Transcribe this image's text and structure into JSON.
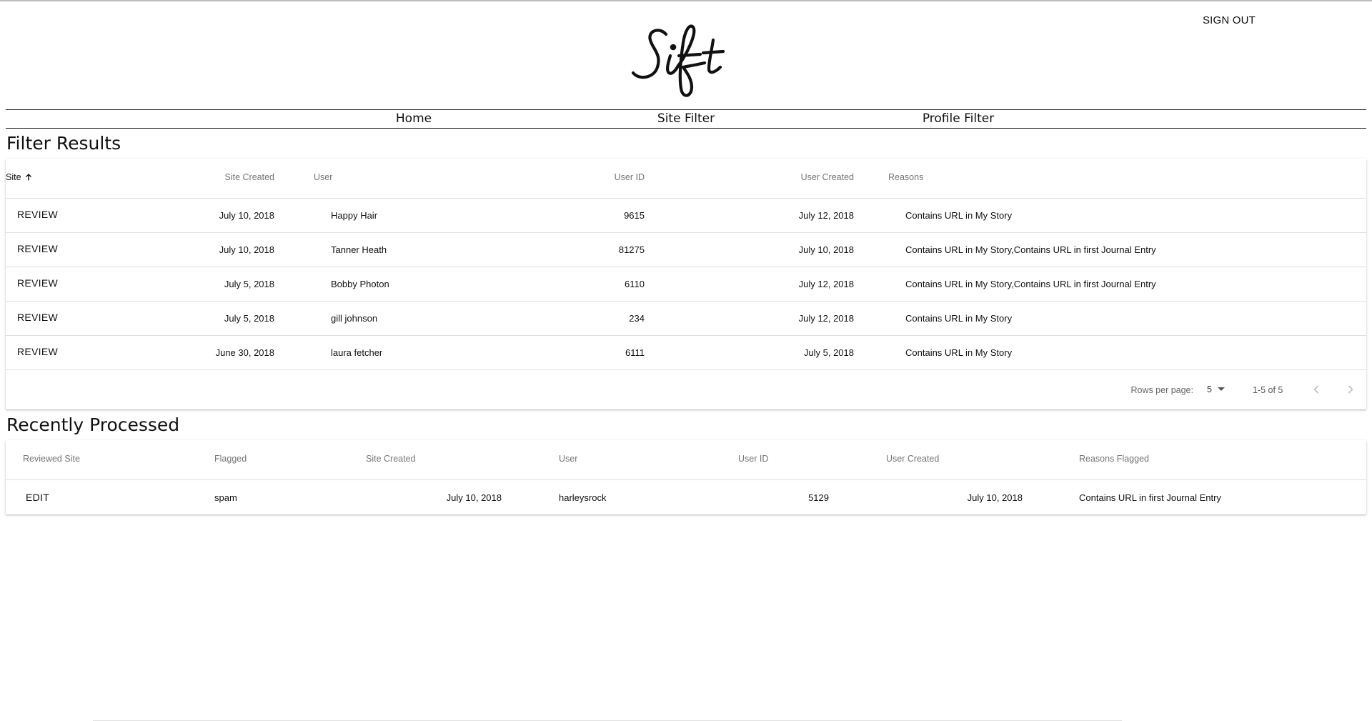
{
  "header": {
    "logo_text": "Sift",
    "sign_out_label": "SIGN OUT"
  },
  "nav": {
    "items": [
      {
        "label": "Home"
      },
      {
        "label": "Site Filter"
      },
      {
        "label": "Profile Filter"
      }
    ]
  },
  "filter_results": {
    "title": "Filter Results",
    "columns": {
      "site": "Site",
      "site_created": "Site Created",
      "user": "User",
      "user_id": "User ID",
      "user_created": "User Created",
      "reasons": "Reasons"
    },
    "sort": {
      "column": "Site",
      "direction": "ascending",
      "icon": "arrow-up-icon"
    },
    "rows": [
      {
        "action": "REVIEW",
        "site_created": "July 10, 2018",
        "user": "Happy Hair",
        "user_id": "9615",
        "user_created": "July 12, 2018",
        "reasons": "Contains URL in My Story"
      },
      {
        "action": "REVIEW",
        "site_created": "July 10, 2018",
        "user": "Tanner Heath",
        "user_id": "81275",
        "user_created": "July 10, 2018",
        "reasons": "Contains URL in My Story,Contains URL in first Journal Entry"
      },
      {
        "action": "REVIEW",
        "site_created": "July 5, 2018",
        "user": "Bobby Photon",
        "user_id": "6110",
        "user_created": "July 12, 2018",
        "reasons": "Contains URL in My Story,Contains URL in first Journal Entry"
      },
      {
        "action": "REVIEW",
        "site_created": "July 5, 2018",
        "user": "gill johnson",
        "user_id": "234",
        "user_created": "July 12, 2018",
        "reasons": "Contains URL in My Story"
      },
      {
        "action": "REVIEW",
        "site_created": "June 30, 2018",
        "user": "laura fetcher",
        "user_id": "6111",
        "user_created": "July 5, 2018",
        "reasons": "Contains URL in My Story"
      }
    ],
    "pagination": {
      "rows_per_page_label": "Rows per page:",
      "rows_per_page": "5",
      "range": "1-5 of 5",
      "prev_icon": "chevron-left-icon",
      "next_icon": "chevron-right-icon"
    }
  },
  "recently_processed": {
    "title": "Recently Processed",
    "columns": {
      "reviewed_site": "Reviewed Site",
      "flagged": "Flagged",
      "site_created": "Site Created",
      "user": "User",
      "user_id": "User ID",
      "user_created": "User Created",
      "reasons_flagged": "Reasons Flagged"
    },
    "rows": [
      {
        "action": "EDIT",
        "flagged": "spam",
        "site_created": "July 10, 2018",
        "user": "harleysrock",
        "user_id": "5129",
        "user_created": "July 10, 2018",
        "reasons_flagged": "Contains URL in first Journal Entry"
      }
    ]
  }
}
